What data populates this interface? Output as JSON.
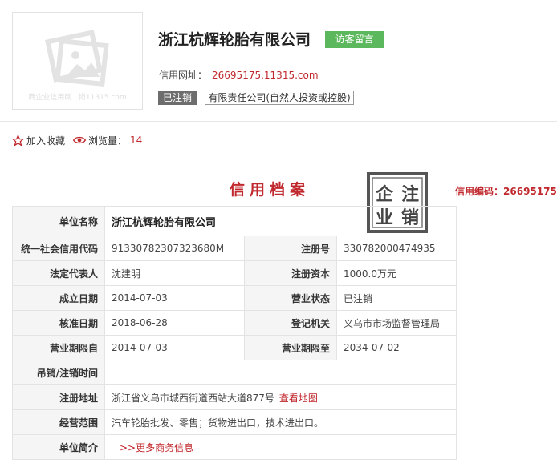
{
  "header": {
    "company_name": "浙江杭辉轮胎有限公司",
    "logo_caption": "商企业信用网 · 尚11315.com",
    "visit_button": "访客留言",
    "site_label": "信用网址：",
    "site_url": "26695175.11315.com",
    "status_tag": "已注销",
    "type_tag": "有限责任公司(自然人投资或控股)"
  },
  "toolbar": {
    "favorite_label": "加入收藏",
    "views_label": "浏览量：",
    "views_count": "14"
  },
  "credit": {
    "title": "信用档案",
    "code_label": "信用编码：",
    "code_value": "26695175",
    "stamp_chars": [
      "企",
      "注",
      "业",
      "销"
    ]
  },
  "table": {
    "name_label": "单位名称",
    "name_value": "浙江杭辉轮胎有限公司",
    "uscc_label": "统一社会信用代码",
    "uscc_value": "91330782307323680M",
    "regno_label": "注册号",
    "regno_value": "330782000474935",
    "legal_label": "法定代表人",
    "legal_value": "沈建明",
    "capital_label": "注册资本",
    "capital_value": "1000.0万元",
    "founded_label": "成立日期",
    "founded_value": "2014-07-03",
    "status_label": "营业状态",
    "status_value": "已注销",
    "approved_label": "核准日期",
    "approved_value": "2018-06-28",
    "authority_label": "登记机关",
    "authority_value": "义乌市市场监督管理局",
    "term_from_label": "营业期限自",
    "term_from_value": "2014-07-03",
    "term_to_label": "营业期限至",
    "term_to_value": "2034-07-02",
    "revoke_label": "吊销/注销时间",
    "revoke_value": "",
    "address_label": "注册地址",
    "address_value": "浙江省义乌市城西街道西站大道877号",
    "map_link": "查看地图",
    "scope_label": "经营范围",
    "scope_value": "汽车轮胎批发、零售；货物进出口，技术进出口。",
    "intro_label": "单位简介",
    "more_link": ">>更多商务信息"
  },
  "colors": {
    "accent_red": "#c0282d",
    "button_green": "#5cb85c",
    "tag_gray": "#6d6d6d"
  }
}
